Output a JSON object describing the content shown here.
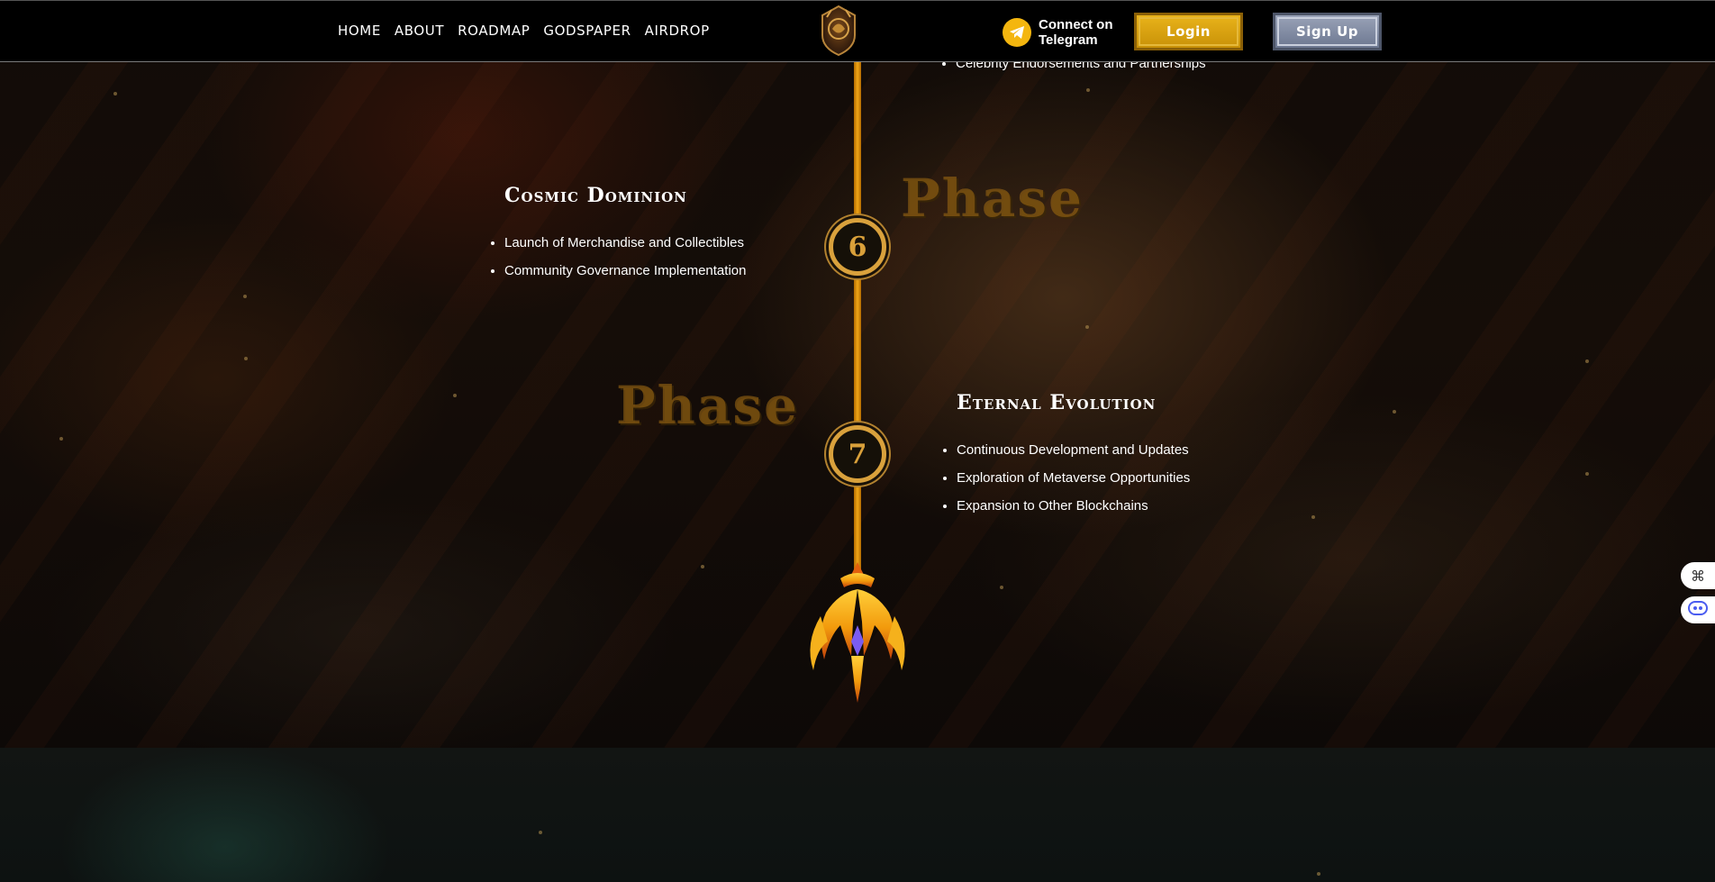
{
  "nav": {
    "items": [
      {
        "label": "HOME"
      },
      {
        "label": "ABOUT"
      },
      {
        "label": "ROADMAP"
      },
      {
        "label": "GODSPAPER"
      },
      {
        "label": "AIRDROP"
      }
    ]
  },
  "header": {
    "telegram_line1": "Connect on",
    "telegram_line2": "Telegram",
    "login_label": "Login",
    "signup_label": "Sign Up"
  },
  "roadmap": {
    "partial_item": "Celebrity Endorsements and Partnerships",
    "phase6": {
      "word": "Phase",
      "number": "6",
      "title": "Cosmic Dominion",
      "items": [
        "Launch of Merchandise and Collectibles",
        "Community Governance Implementation"
      ]
    },
    "phase7": {
      "word": "Phase",
      "number": "7",
      "title": "Eternal Evolution",
      "items": [
        "Continuous Development and Updates",
        "Exploration of Metaverse Opportunities",
        "Expansion to Other Blockchains"
      ]
    }
  },
  "colors": {
    "accent_gold": "#f0a617",
    "login_gold": "#e9b31a",
    "signup_steel": "#8c96ab"
  },
  "icons": {
    "telegram": "telegram-icon",
    "logo": "logo-emblem",
    "trident": "trident-icon",
    "widget_top": "command-icon",
    "widget_bottom": "assistant-icon"
  }
}
